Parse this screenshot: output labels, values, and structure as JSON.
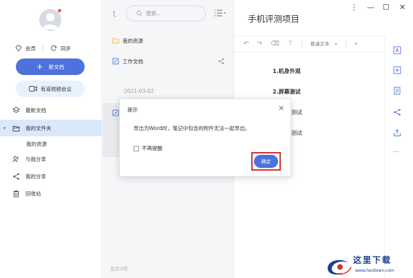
{
  "sidebar": {
    "vip_label": "会员",
    "sync_label": "同步",
    "new_doc_label": "新文档",
    "meeting_label": "有道视频会议",
    "items": [
      {
        "label": "最新文档"
      },
      {
        "label": "我的文件夹"
      },
      {
        "label": "我的资源"
      },
      {
        "label": "与我分享"
      },
      {
        "label": "我的分享"
      },
      {
        "label": "回收站"
      }
    ]
  },
  "list": {
    "search_placeholder": "搜索...",
    "items": [
      {
        "label": "我的资源"
      },
      {
        "label": "工作文档"
      }
    ],
    "date": "2021-03-02",
    "footer": "总共3项"
  },
  "editor": {
    "title": "手机评测项目",
    "style_select": "普通文本",
    "lines": [
      "1.机身外观",
      "2.屏幕测试",
      "测试",
      "测试"
    ]
  },
  "dialog": {
    "title": "提示",
    "message": "导出为Word时，笔记中包含的附件无法一起导出。",
    "checkbox_label": "不再提醒",
    "ok_label": "确定"
  },
  "watermark": {
    "text": "这里下载",
    "url": "www.herdown.com"
  },
  "colors": {
    "accent": "#4d72dc",
    "active_bg": "#dbe7fb",
    "highlight": "#d32f2f"
  }
}
